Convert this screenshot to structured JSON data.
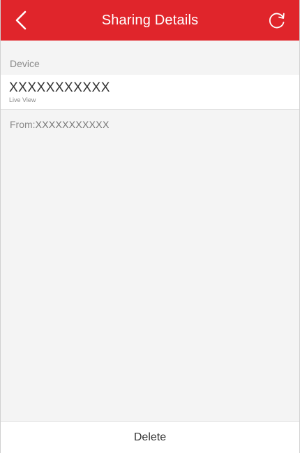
{
  "header": {
    "title": "Sharing Details",
    "background_color": "#e0252b",
    "back_icon": "chevron-left-icon",
    "refresh_icon": "refresh-icon"
  },
  "device_section": {
    "label": "Device",
    "device": {
      "name": "XXXXXXXXXXX",
      "permission": "Live View"
    }
  },
  "from": {
    "prefix": "From:",
    "value": "XXXXXXXXXXX"
  },
  "footer": {
    "delete_label": "Delete"
  }
}
